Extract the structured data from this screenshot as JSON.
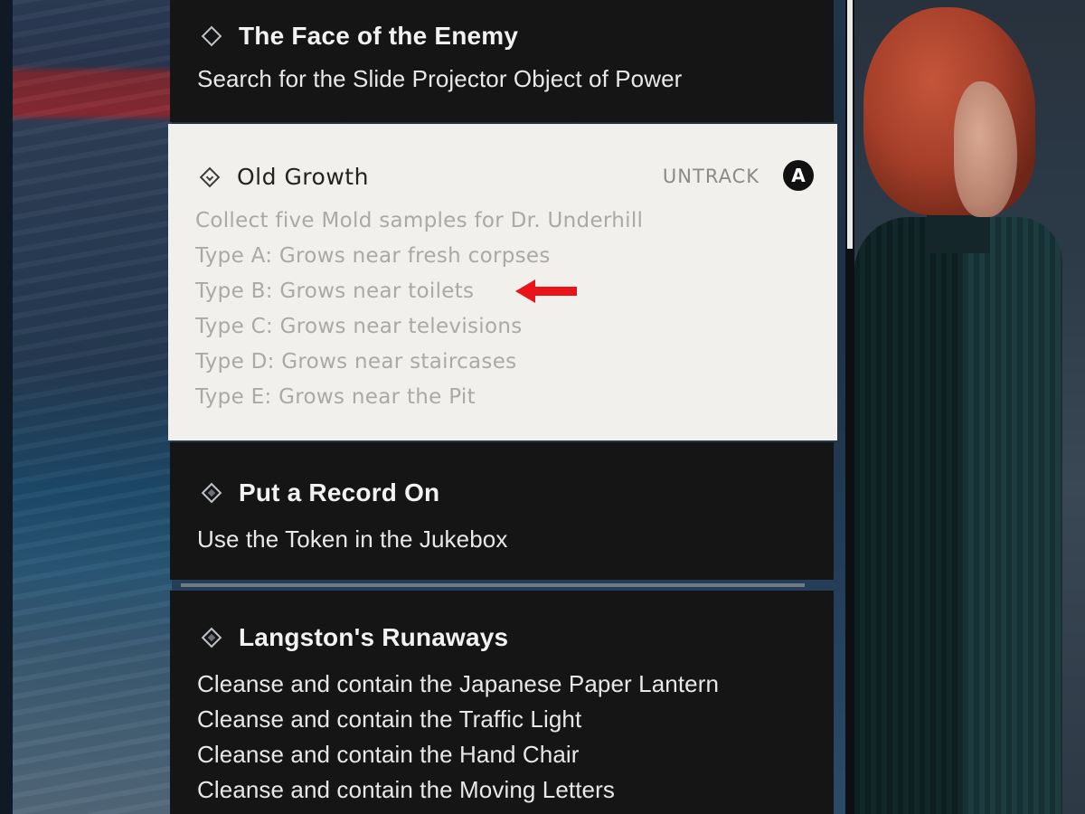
{
  "quests": [
    {
      "title": "The Face of the Enemy",
      "lines": [
        "Search for the Slide Projector Object of Power"
      ],
      "icon": "diamond-icon"
    },
    {
      "title": "Old Growth",
      "action_label": "UNTRACK",
      "button_glyph": "A",
      "lines": [
        "Collect five Mold samples for Dr. Underhill",
        "Type A: Grows near fresh corpses",
        "Type B: Grows near toilets",
        "Type C: Grows near televisions",
        "Type D: Grows near staircases",
        "Type E: Grows near the Pit"
      ],
      "icon": "diamond-check-icon",
      "selected": true
    },
    {
      "title": "Put a Record On",
      "lines": [
        "Use the Token in the Jukebox"
      ],
      "icon": "diamond-icon"
    },
    {
      "title": "Langston's Runaways",
      "lines": [
        "Cleanse and contain the Japanese Paper Lantern",
        "Cleanse and contain the Traffic Light",
        "Cleanse and contain the Hand Chair",
        "Cleanse and contain the Moving Letters"
      ],
      "icon": "diamond-icon"
    }
  ],
  "annotation": {
    "icon": "red-arrow-icon",
    "color": "#e8141a"
  },
  "colors": {
    "panel_dark": "#151515",
    "panel_selected": "#f1f0ec",
    "text_light": "#e8e8e8",
    "text_muted": "#a9a9a9"
  }
}
